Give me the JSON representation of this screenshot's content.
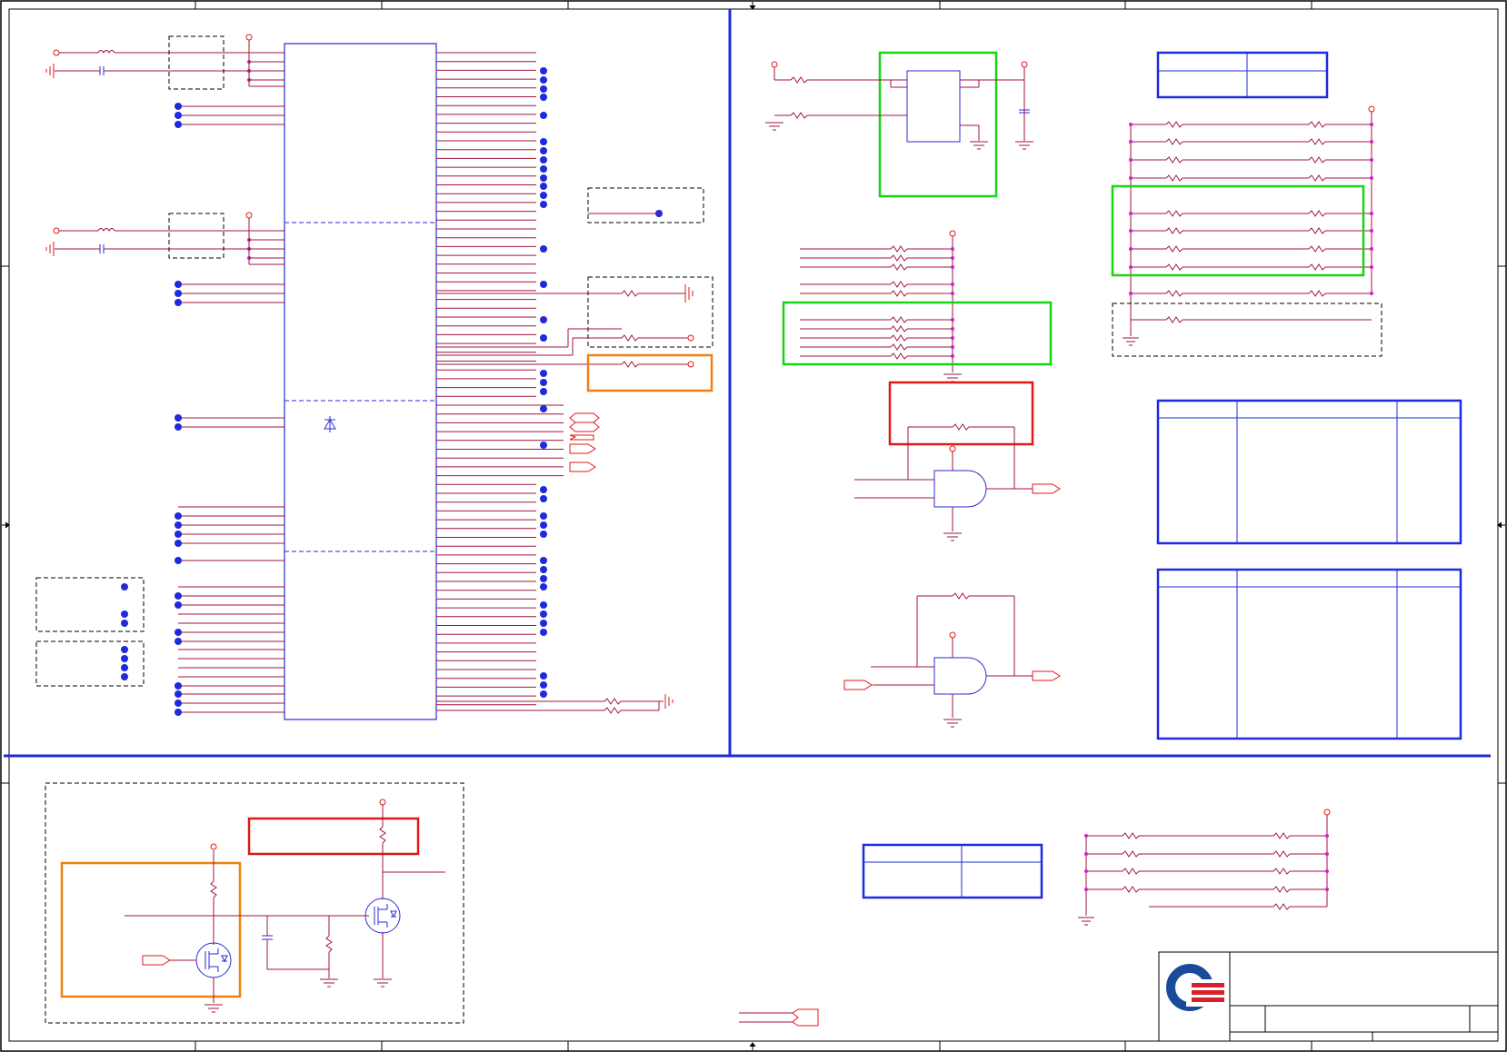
{
  "title_block": {
    "logo": "company-logo-icon"
  },
  "colors": {
    "wire": "#a0143c",
    "net_dot": "#d020d0",
    "bus": "#1e2adc",
    "component_red": "#e01818",
    "ic_outline": "#2a2ad8",
    "frame": "#000000",
    "highlight_green": "#16d416",
    "highlight_red": "#e01818",
    "highlight_orange": "#f08010",
    "dashed_group": "#000000"
  }
}
